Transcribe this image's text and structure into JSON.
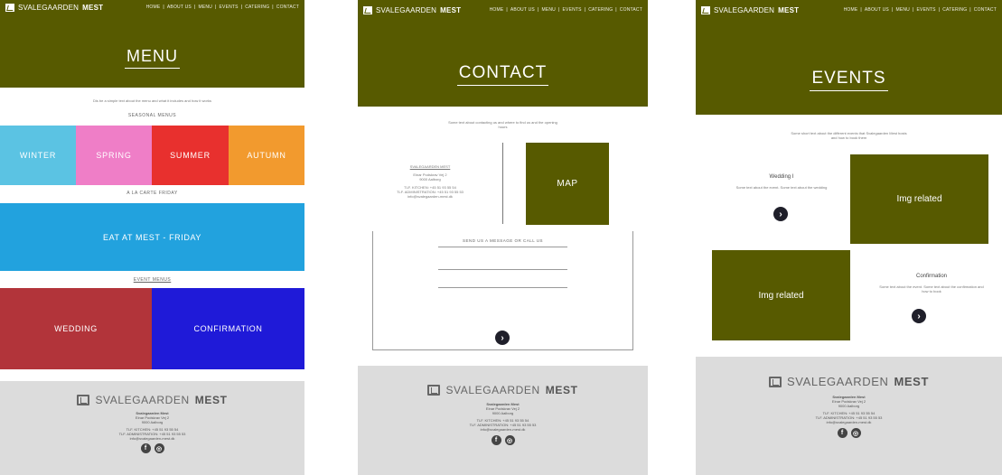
{
  "brand": {
    "name_light": "SVALEGAARDEN",
    "name_bold": "MEST"
  },
  "nav": [
    "HOME",
    "ABOUT US",
    "MENU",
    "EVENTS",
    "CATERING",
    "CONTACT"
  ],
  "colors": {
    "olive": "#575a00",
    "winter": "#5bc3e3",
    "spring": "#ef7ec7",
    "summer": "#e8302e",
    "autumn": "#f29a2e",
    "eat_blue": "#22a2de",
    "wedding": "#b2343a",
    "confirmation": "#1f1ad8",
    "footer_gray": "#dcdcdc"
  },
  "menu_page": {
    "title": "MENU",
    "intro": "Dis be a simple text about the menu and what it includes and how it works",
    "seasonal_heading": "SEASONAL MENUS",
    "seasons": [
      "WINTER",
      "SPRING",
      "SUMMER",
      "AUTUMN"
    ],
    "eat_heading": "A LA CARTE FRIDAY",
    "eat_label": "EAT AT MEST - FRIDAY",
    "event_heading": "EVENT MENUS",
    "events": [
      "WEDDING",
      "CONFIRMATION"
    ]
  },
  "contact_page": {
    "title": "CONTACT",
    "intro": "Some text about contacting us and where to find us and the opening hours",
    "address_heading": "SVALEGAARDEN MEST",
    "address_lines": [
      "Einar Podskrav Vej 2",
      "9000 Aalborg",
      "TLF. KITCHEN: +45 51 93 55 54",
      "TLF. ADMINISTRATION: +45 51 93 55 53",
      "info@svalegaarden-mest.dk"
    ],
    "map_label": "MAP",
    "form_heading": "SEND US A MESSAGE OR CALL US"
  },
  "events_page": {
    "title": "EVENTS",
    "intro": "Some short text about the different events that Svalegaarden Mest hosts and how to book them",
    "event1_title": "Wedding I",
    "event1_text": "Some text about the event. Some text about the wedding",
    "img_label": "Img related",
    "event2_title": "Confirmation",
    "event2_text": "Some text about the event. Some text about the confirmation and how to book"
  },
  "footer": {
    "name": "Svalegaarden Mest",
    "address1": "Einar Podskrav Vej 2",
    "address2": "9000 Aalborg",
    "tel_kitchen": "TLF. KITCHEN: +45 51 93 55 54",
    "tel_admin": "TLF. ADMINISTRATION: +45 51 93 55 53",
    "email": "info@svalegaarden-mest.dk",
    "social_f": "f",
    "social_i": "◎"
  }
}
